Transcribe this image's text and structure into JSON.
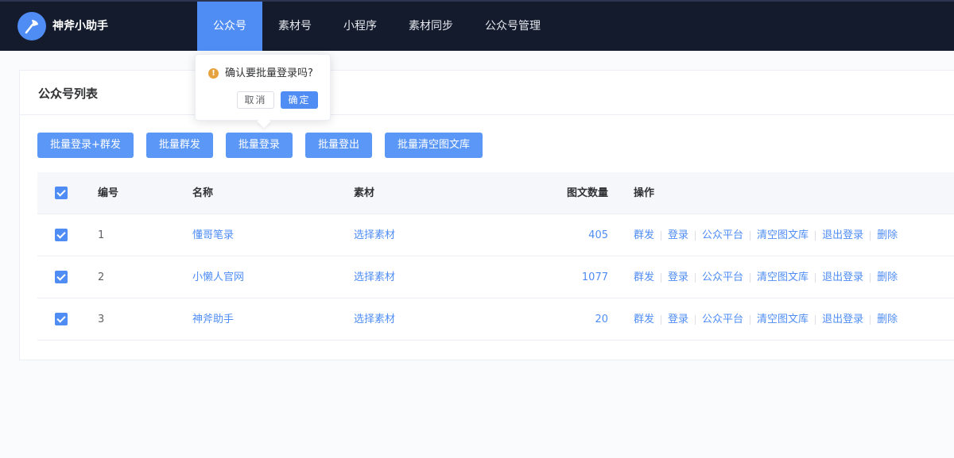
{
  "header": {
    "brand": "神斧小助手",
    "nav": [
      "公众号",
      "素材号",
      "小程序",
      "素材同步",
      "公众号管理"
    ],
    "active_index": 0
  },
  "card": {
    "title": "公众号列表",
    "buttons": [
      "批量登录+群发",
      "批量群发",
      "批量登录",
      "批量登出",
      "批量清空图文库"
    ]
  },
  "table": {
    "headers": {
      "id": "编号",
      "name": "名称",
      "material": "素材",
      "count": "图文数量",
      "ops": "操作"
    },
    "rows": [
      {
        "id": "1",
        "name": "懂哥笔录",
        "material": "选择素材",
        "count": "405",
        "checked": true
      },
      {
        "id": "2",
        "name": "小懒人官网",
        "material": "选择素材",
        "count": "1077",
        "checked": true
      },
      {
        "id": "3",
        "name": "神斧助手",
        "material": "选择素材",
        "count": "20",
        "checked": true
      }
    ],
    "actions": [
      "群发",
      "登录",
      "公众平台",
      "清空图文库",
      "退出登录",
      "删除"
    ]
  },
  "popover": {
    "message": "确认要批量登录吗?",
    "cancel": "取消",
    "confirm": "确定",
    "icon": "!"
  },
  "colors": {
    "header_bg": "#141b2d",
    "accent": "#4f8df5",
    "warning": "#e6a23c"
  }
}
